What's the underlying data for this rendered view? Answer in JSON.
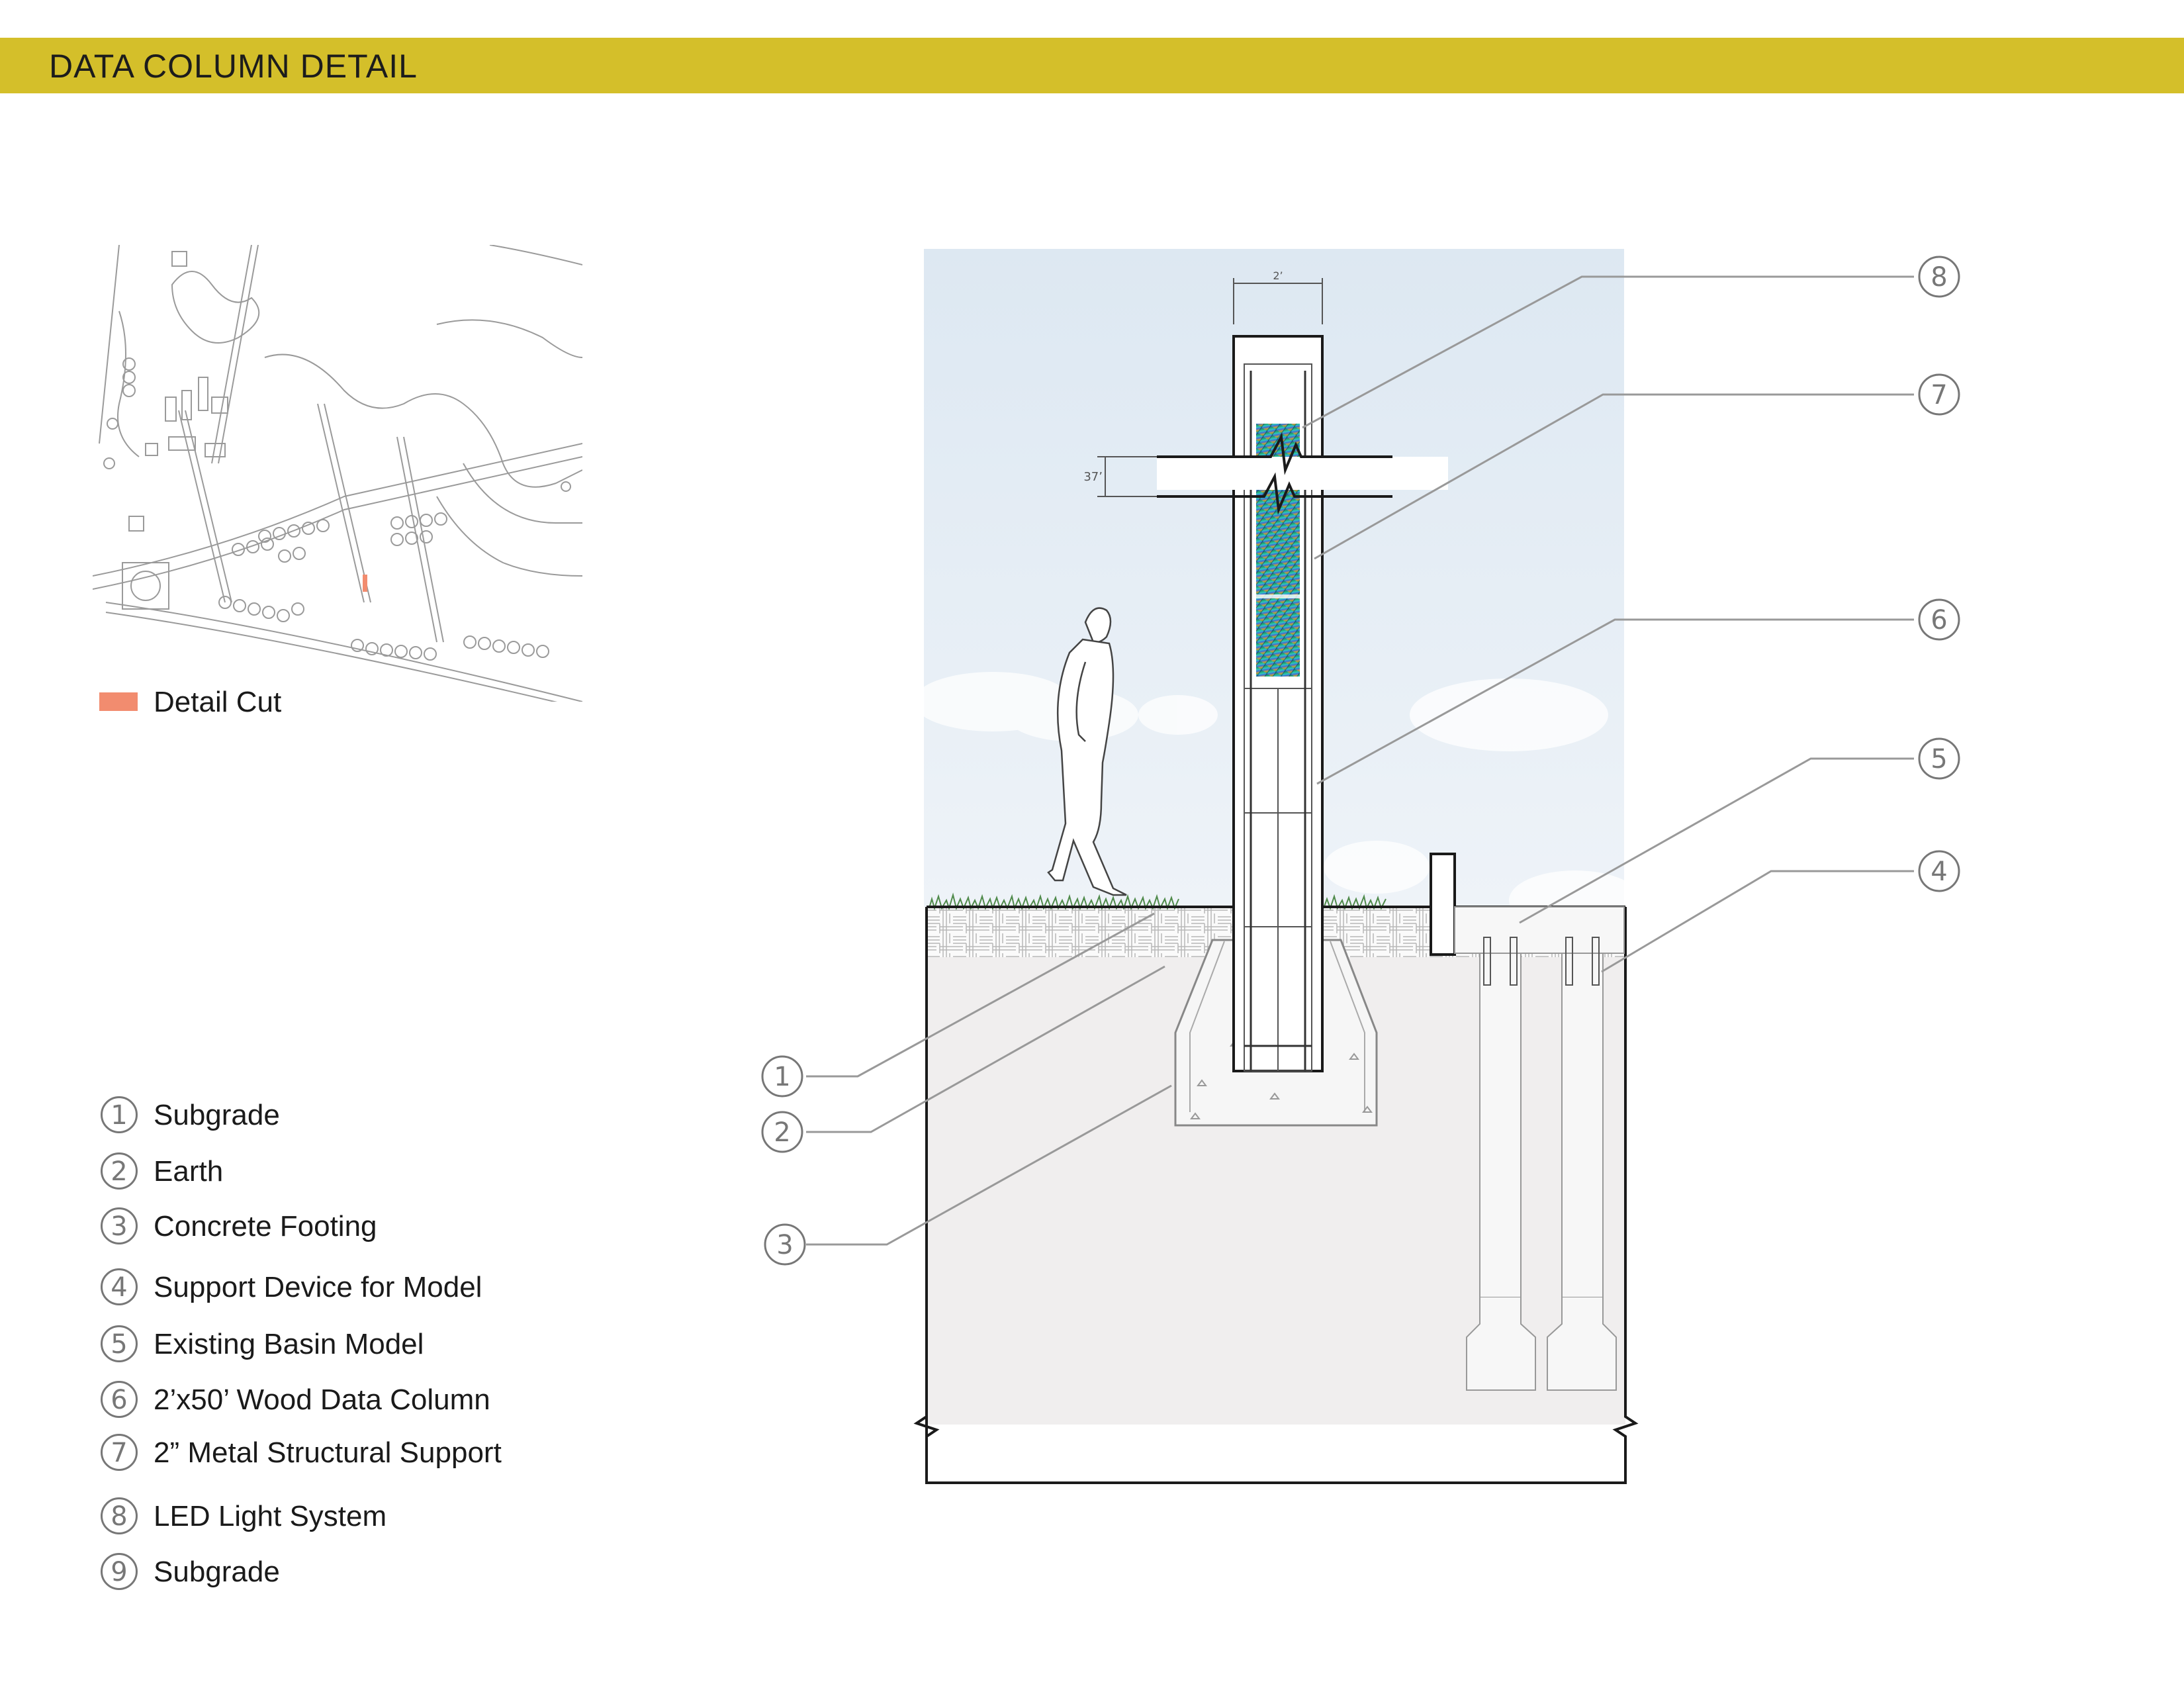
{
  "header": {
    "title": "DATA COLUMN DETAIL",
    "band_color": "#d4bf2a"
  },
  "site_map": {
    "legend_label": "Detail Cut",
    "legend_color": "#f28c6f"
  },
  "legend": {
    "items": [
      {
        "num": "1",
        "label": "Subgrade"
      },
      {
        "num": "2",
        "label": "Earth"
      },
      {
        "num": "3",
        "label": "Concrete Footing"
      },
      {
        "num": "4",
        "label": "Support Device for Model"
      },
      {
        "num": "5",
        "label": "Existing Basin Model"
      },
      {
        "num": "6",
        "label": "2’x50’ Wood Data Column"
      },
      {
        "num": "7",
        "label": "2” Metal Structural Support"
      },
      {
        "num": "8",
        "label": "LED Light System"
      },
      {
        "num": "9",
        "label": "Subgrade"
      }
    ]
  },
  "section": {
    "dim_width": "2’",
    "dim_break": "37’",
    "callouts": [
      "8",
      "7",
      "6",
      "5",
      "4",
      "1",
      "2",
      "3"
    ]
  }
}
